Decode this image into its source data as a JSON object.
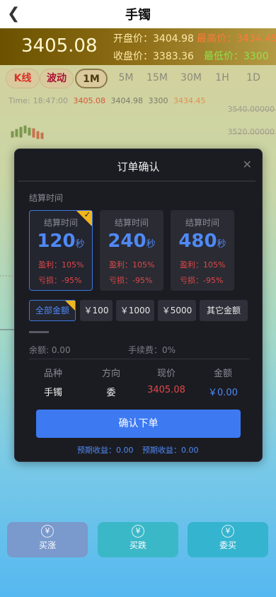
{
  "header": {
    "title": "手镯",
    "back_icon": "chevron-left-icon"
  },
  "price": {
    "current": "3405.08",
    "open_label": "开盘价：",
    "open_value": "3404.98",
    "high_label": "最高价：",
    "high_value": "3434.45",
    "close_label": "收盘价：",
    "close_value": "3383.36",
    "low_label": "最低价：",
    "low_value": "3300"
  },
  "tabs": [
    "K线",
    "波动",
    "1M",
    "5M",
    "15M",
    "30M",
    "1H",
    "1D"
  ],
  "timeline": {
    "label": "Time:",
    "time": "18:47:00",
    "v1": "3405.08",
    "v2": "3404.98",
    "v3": "3300",
    "v4": "3434.45"
  },
  "axis": [
    "3540.00000",
    "3520.00000"
  ],
  "modal": {
    "title": "订单确认",
    "close_icon": "close-icon",
    "section_label": "结算时间",
    "time_options": [
      {
        "header": "结算时间",
        "value": "120",
        "unit": "秒",
        "profit": "盈利：105%",
        "loss": "亏损：-95%"
      },
      {
        "header": "结算时间",
        "value": "240",
        "unit": "秒",
        "profit": "盈利：105%",
        "loss": "亏损：-95%"
      },
      {
        "header": "结算时间",
        "value": "480",
        "unit": "秒",
        "profit": "盈利：105%",
        "loss": "亏损：-95%"
      }
    ],
    "amounts": [
      "全部金额",
      "￥100",
      "￥1000",
      "￥5000",
      "其它金额"
    ],
    "balance": "余额: 0.00",
    "fee": "手续费：0%",
    "columns": {
      "headers": [
        "品种",
        "方向",
        "现价",
        "金额"
      ],
      "values": [
        "手镯",
        "委",
        "3405.08",
        "￥0.00"
      ]
    },
    "confirm_label": "确认下单",
    "expected1": "预期收益：0.00",
    "expected2": "预期收益：0.00"
  },
  "actions": {
    "buy_up": "买涨",
    "buy_down": "买跌",
    "entrust": "委买"
  },
  "colors": {
    "accent": "#3d7af2",
    "up": "#e04848",
    "highlight": "#f1b51f"
  }
}
